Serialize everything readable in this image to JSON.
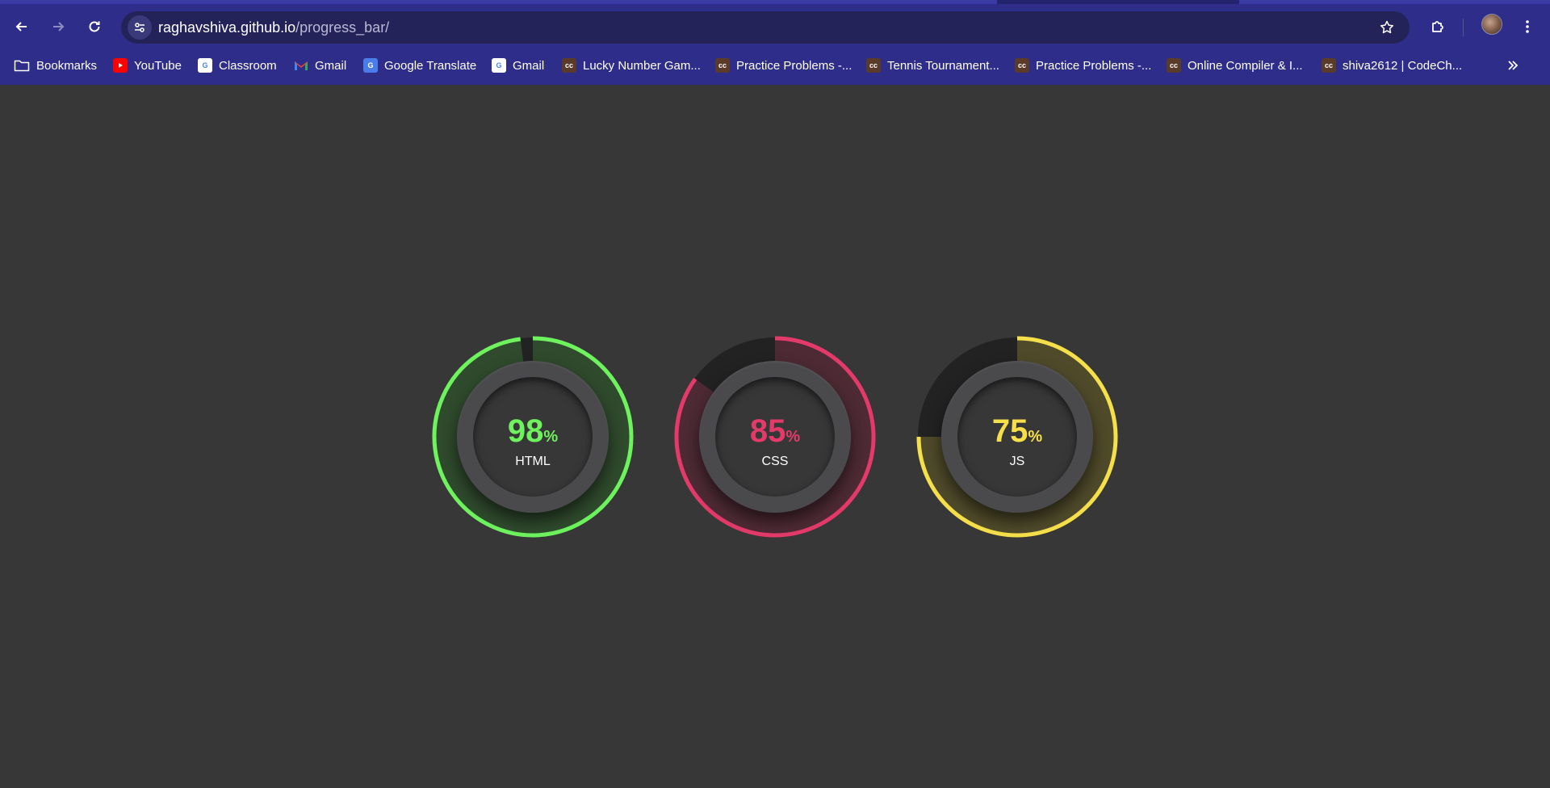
{
  "browser": {
    "url_domain": "raghavshiva.github.io",
    "url_path": "/progress_bar/"
  },
  "bookmarks": [
    {
      "label": "Bookmarks",
      "icon": "folder-icon"
    },
    {
      "label": "YouTube",
      "icon": "youtube-icon"
    },
    {
      "label": "Classroom",
      "icon": "google-icon"
    },
    {
      "label": "Gmail",
      "icon": "gmail-icon"
    },
    {
      "label": "Google Translate",
      "icon": "google-translate-icon"
    },
    {
      "label": "Gmail",
      "icon": "google-icon"
    },
    {
      "label": "Lucky Number Gam...",
      "icon": "codechef-icon"
    },
    {
      "label": "Practice Problems -...",
      "icon": "codechef-icon"
    },
    {
      "label": "Tennis Tournament...",
      "icon": "codechef-icon"
    },
    {
      "label": "Practice Problems -...",
      "icon": "codechef-icon"
    },
    {
      "label": "Online Compiler & I...",
      "icon": "codechef-icon"
    },
    {
      "label": "shiva2612 | CodeCh...",
      "icon": "codechef-icon"
    }
  ],
  "progress": [
    {
      "value": "98",
      "unit": "%",
      "name": "HTML",
      "percent": 98,
      "color": "#6ef25e",
      "fill": "#2f4a2d"
    },
    {
      "value": "85",
      "unit": "%",
      "name": "CSS",
      "percent": 85,
      "color": "#e43a6a",
      "fill": "#4d2a34"
    },
    {
      "value": "75",
      "unit": "%",
      "name": "JS",
      "percent": 75,
      "color": "#f5df4a",
      "fill": "#4f4a2a"
    }
  ]
}
